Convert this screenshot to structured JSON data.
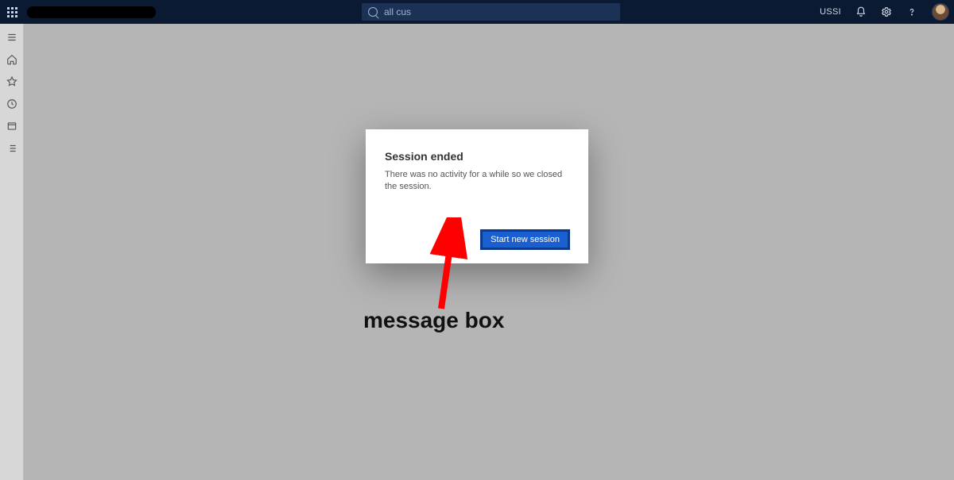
{
  "header": {
    "search_value": "all cus",
    "org_label": "USSI"
  },
  "dialog": {
    "title": "Session ended",
    "message": "There was no activity for a while so we closed the session.",
    "primary_button": "Start new session"
  },
  "annotation": {
    "label": "message box"
  },
  "sidebar": {
    "items": [
      "menu",
      "home",
      "favorites",
      "recent",
      "workspace",
      "list"
    ]
  }
}
